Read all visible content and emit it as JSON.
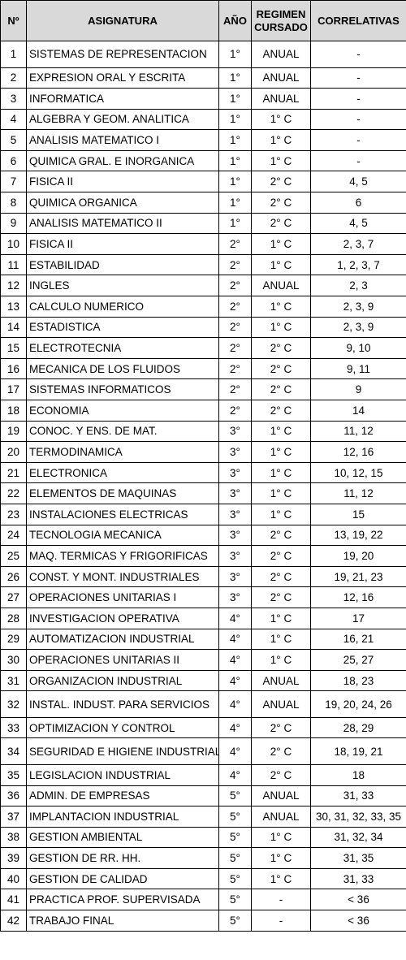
{
  "headers": {
    "num": "Nº",
    "asignatura": "ASIGNATURA",
    "anio": "AÑO",
    "regimen_line1": "REGIMEN",
    "regimen_line2": "CURSADO",
    "correlativas": "CORRELATIVAS"
  },
  "rows": [
    {
      "num": "1",
      "asignatura": "SISTEMAS DE REPRESENTACION",
      "anio": "1°",
      "regimen": "ANUAL",
      "correlativas": "-",
      "tall": true
    },
    {
      "num": "2",
      "asignatura": "EXPRESION ORAL Y ESCRITA",
      "anio": "1°",
      "regimen": "ANUAL",
      "correlativas": "-"
    },
    {
      "num": "3",
      "asignatura": "INFORMATICA",
      "anio": "1°",
      "regimen": "ANUAL",
      "correlativas": "-"
    },
    {
      "num": "4",
      "asignatura": "ALGEBRA Y GEOM. ANALITICA",
      "anio": "1°",
      "regimen": "1° C",
      "correlativas": "-"
    },
    {
      "num": "5",
      "asignatura": "ANALISIS MATEMATICO I",
      "anio": "1°",
      "regimen": "1° C",
      "correlativas": "-"
    },
    {
      "num": "6",
      "asignatura": "QUIMICA GRAL. E INORGANICA",
      "anio": "1°",
      "regimen": "1° C",
      "correlativas": "-"
    },
    {
      "num": "7",
      "asignatura": "FISICA II",
      "anio": "1°",
      "regimen": "2° C",
      "correlativas": "4, 5"
    },
    {
      "num": "8",
      "asignatura": "QUIMICA ORGANICA",
      "anio": "1°",
      "regimen": "2° C",
      "correlativas": "6"
    },
    {
      "num": "9",
      "asignatura": "ANALISIS MATEMATICO II",
      "anio": "1°",
      "regimen": "2° C",
      "correlativas": "4, 5"
    },
    {
      "num": "10",
      "asignatura": "FISICA II",
      "anio": "2°",
      "regimen": "1° C",
      "correlativas": "2, 3, 7"
    },
    {
      "num": "11",
      "asignatura": "ESTABILIDAD",
      "anio": "2°",
      "regimen": "1° C",
      "correlativas": "1, 2, 3, 7"
    },
    {
      "num": "12",
      "asignatura": "INGLES",
      "anio": "2°",
      "regimen": "ANUAL",
      "correlativas": "2, 3"
    },
    {
      "num": "13",
      "asignatura": "CALCULO NUMERICO",
      "anio": "2°",
      "regimen": "1° C",
      "correlativas": "2, 3, 9"
    },
    {
      "num": "14",
      "asignatura": "ESTADISTICA",
      "anio": "2°",
      "regimen": "1° C",
      "correlativas": "2, 3, 9"
    },
    {
      "num": "15",
      "asignatura": "ELECTROTECNIA",
      "anio": "2°",
      "regimen": "2° C",
      "correlativas": "9, 10"
    },
    {
      "num": "16",
      "asignatura": "MECANICA DE LOS FLUIDOS",
      "anio": "2°",
      "regimen": "2° C",
      "correlativas": "9, 11"
    },
    {
      "num": "17",
      "asignatura": "SISTEMAS INFORMATICOS",
      "anio": "2°",
      "regimen": "2° C",
      "correlativas": "9"
    },
    {
      "num": "18",
      "asignatura": "ECONOMIA",
      "anio": "2°",
      "regimen": "2° C",
      "correlativas": "14"
    },
    {
      "num": "19",
      "asignatura": "CONOC. Y ENS. DE MAT.",
      "anio": "3°",
      "regimen": "1° C",
      "correlativas": "11, 12"
    },
    {
      "num": "20",
      "asignatura": "TERMODINAMICA",
      "anio": "3°",
      "regimen": "1° C",
      "correlativas": "12, 16"
    },
    {
      "num": "21",
      "asignatura": "ELECTRONICA",
      "anio": "3°",
      "regimen": "1° C",
      "correlativas": "10, 12, 15"
    },
    {
      "num": "22",
      "asignatura": "ELEMENTOS DE MAQUINAS",
      "anio": "3°",
      "regimen": "1° C",
      "correlativas": "11, 12"
    },
    {
      "num": "23",
      "asignatura": "INSTALACIONES ELECTRICAS",
      "anio": "3°",
      "regimen": "1° C",
      "correlativas": "15"
    },
    {
      "num": "24",
      "asignatura": "TECNOLOGIA MECANICA",
      "anio": "3°",
      "regimen": "2° C",
      "correlativas": "13, 19, 22"
    },
    {
      "num": "25",
      "asignatura": "MAQ. TERMICAS Y FRIGORIFICAS",
      "anio": "3°",
      "regimen": "2° C",
      "correlativas": "19, 20"
    },
    {
      "num": "26",
      "asignatura": "CONST. Y MONT. INDUSTRIALES",
      "anio": "3°",
      "regimen": "2° C",
      "correlativas": "19, 21, 23"
    },
    {
      "num": "27",
      "asignatura": "OPERACIONES UNITARIAS I",
      "anio": "3°",
      "regimen": "2° C",
      "correlativas": "12, 16"
    },
    {
      "num": "28",
      "asignatura": "INVESTIGACION OPERATIVA",
      "anio": "4°",
      "regimen": "1° C",
      "correlativas": "17"
    },
    {
      "num": "29",
      "asignatura": "AUTOMATIZACION INDUSTRIAL",
      "anio": "4°",
      "regimen": "1° C",
      "correlativas": "16, 21"
    },
    {
      "num": "30",
      "asignatura": "OPERACIONES UNITARIAS II",
      "anio": "4°",
      "regimen": "1° C",
      "correlativas": "25, 27"
    },
    {
      "num": "31",
      "asignatura": "ORGANIZACION INDUSTRIAL",
      "anio": "4°",
      "regimen": "ANUAL",
      "correlativas": "18, 23"
    },
    {
      "num": "32",
      "asignatura": "INSTAL. INDUST. PARA SERVICIOS",
      "anio": "4°",
      "regimen": "ANUAL",
      "correlativas": "19, 20, 24, 26",
      "tall": true
    },
    {
      "num": "33",
      "asignatura": "OPTIMIZACION Y CONTROL",
      "anio": "4°",
      "regimen": "2° C",
      "correlativas": "28, 29"
    },
    {
      "num": "34",
      "asignatura": "SEGURIDAD E HIGIENE INDUSTRIAL",
      "anio": "4°",
      "regimen": "2° C",
      "correlativas": "18, 19, 21",
      "tall": true
    },
    {
      "num": "35",
      "asignatura": "LEGISLACION INDUSTRIAL",
      "anio": "4°",
      "regimen": "2° C",
      "correlativas": "18"
    },
    {
      "num": "36",
      "asignatura": "ADMIN. DE EMPRESAS",
      "anio": "5°",
      "regimen": "ANUAL",
      "correlativas": "31, 33"
    },
    {
      "num": "37",
      "asignatura": "IMPLANTACION INDUSTRIAL",
      "anio": "5°",
      "regimen": "ANUAL",
      "correlativas": "30, 31, 32, 33, 35"
    },
    {
      "num": "38",
      "asignatura": "GESTION AMBIENTAL",
      "anio": "5°",
      "regimen": "1° C",
      "correlativas": "31, 32, 34"
    },
    {
      "num": "39",
      "asignatura": "GESTION DE RR. HH.",
      "anio": "5°",
      "regimen": "1° C",
      "correlativas": "31, 35"
    },
    {
      "num": "40",
      "asignatura": "GESTION DE CALIDAD",
      "anio": "5°",
      "regimen": "1° C",
      "correlativas": "31, 33"
    },
    {
      "num": "41",
      "asignatura": "PRACTICA PROF. SUPERVISADA",
      "anio": "5°",
      "regimen": "-",
      "correlativas": "< 36"
    },
    {
      "num": "42",
      "asignatura": "TRABAJO FINAL",
      "anio": "5°",
      "regimen": "-",
      "correlativas": "< 36"
    }
  ]
}
